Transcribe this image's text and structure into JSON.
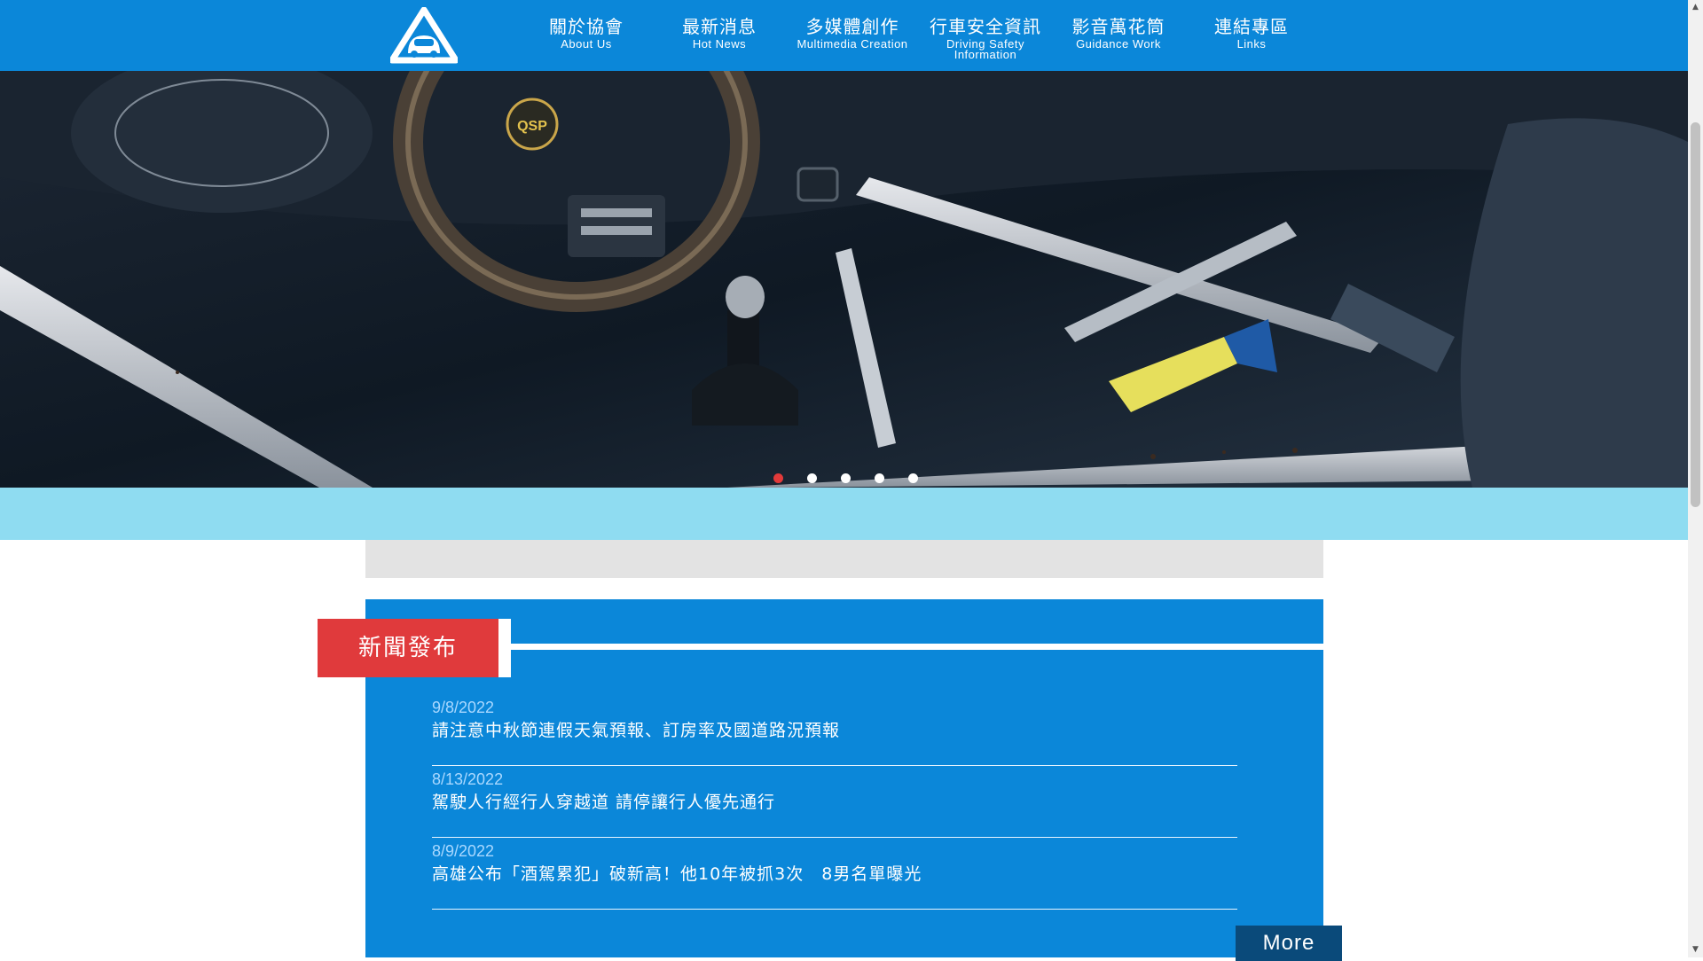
{
  "nav": {
    "items": [
      {
        "zh": "關於協會",
        "en": "About Us"
      },
      {
        "zh": "最新消息",
        "en": "Hot News"
      },
      {
        "zh": "多媒體創作",
        "en": "Multimedia Creation"
      },
      {
        "zh": "行車安全資訊",
        "en": "Driving Safety Information"
      },
      {
        "zh": "影音萬花筒",
        "en": "Guidance Work"
      },
      {
        "zh": "連結專區",
        "en": "Links"
      }
    ]
  },
  "hero": {
    "slide_count": 5,
    "active_slide": 1,
    "gauge_label": "QSP"
  },
  "news": {
    "heading": "新聞發布",
    "items": [
      {
        "date": "9/8/2022",
        "title": "請注意中秋節連假天氣預報、訂房率及國道路況預報"
      },
      {
        "date": "8/13/2022",
        "title": "駕駛人行經行人穿越道 請停讓行人優先通行"
      },
      {
        "date": "8/9/2022",
        "title": "高雄公布「酒駕累犯」破新高！他10年被抓3次　8男名單曝光"
      }
    ],
    "more_label": "More"
  },
  "colors": {
    "nav_blue": "#0b87d9",
    "light_band": "#8fdcf1",
    "news_red": "#e03a3c",
    "more_dark": "#0a4a7a"
  },
  "icons": {
    "logo": "triangle-car-logo-icon",
    "scroll_up": "scroll-up-arrow-icon",
    "scroll_down": "scroll-down-arrow-icon"
  }
}
